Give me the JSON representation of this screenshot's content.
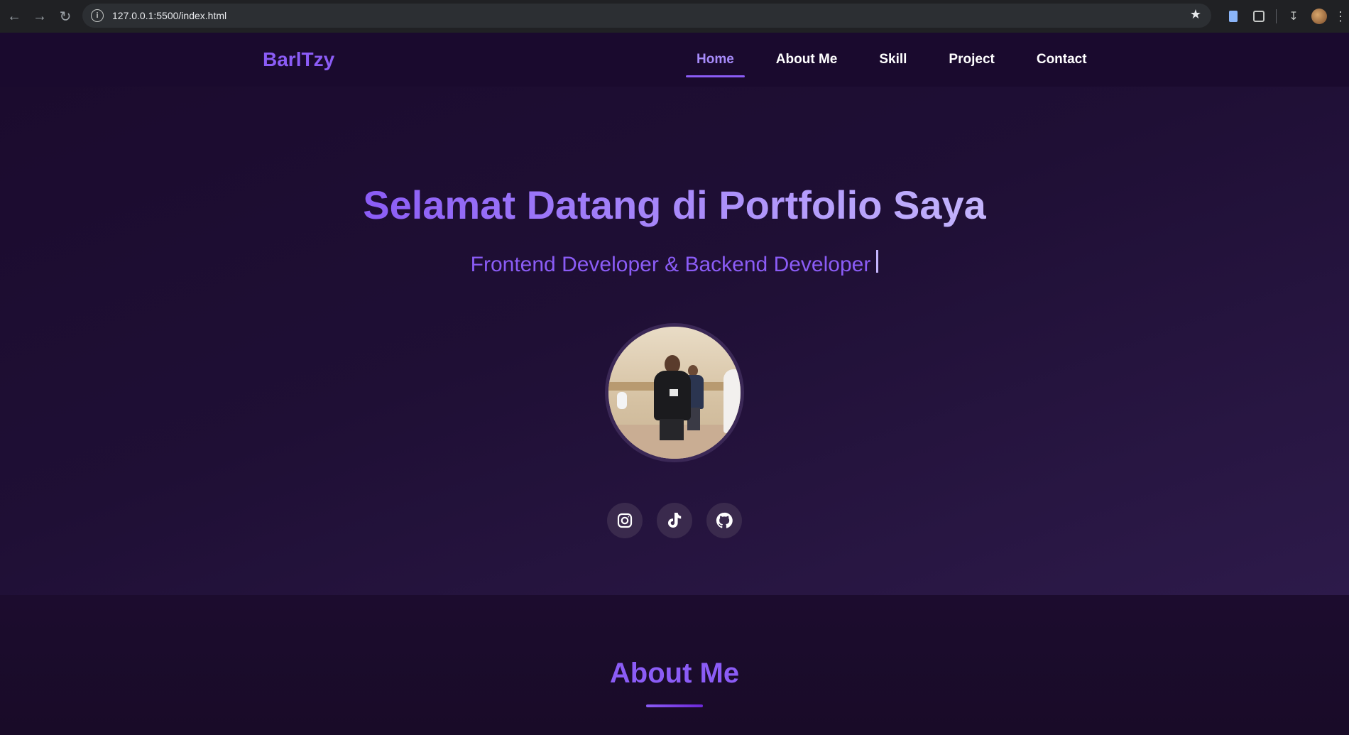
{
  "browser": {
    "url": "127.0.0.1:5500/index.html"
  },
  "site": {
    "logo": "BarlTzy",
    "nav": [
      {
        "label": "Home",
        "active": true
      },
      {
        "label": "About Me",
        "active": false
      },
      {
        "label": "Skill",
        "active": false
      },
      {
        "label": "Project",
        "active": false
      },
      {
        "label": "Contact",
        "active": false
      }
    ]
  },
  "hero": {
    "title": "Selamat Datang di Portfolio Saya",
    "subtitle": "Frontend Developer & Backend Developer",
    "socials": [
      {
        "icon": "instagram-icon"
      },
      {
        "icon": "tiktok-icon"
      },
      {
        "icon": "github-icon"
      }
    ]
  },
  "about": {
    "title": "About Me"
  },
  "colors": {
    "accent": "#8b5cf6",
    "accent_light": "#c4b5fd",
    "header_bg": "#1a0a2e",
    "social_bg": "#3a2a4d"
  }
}
